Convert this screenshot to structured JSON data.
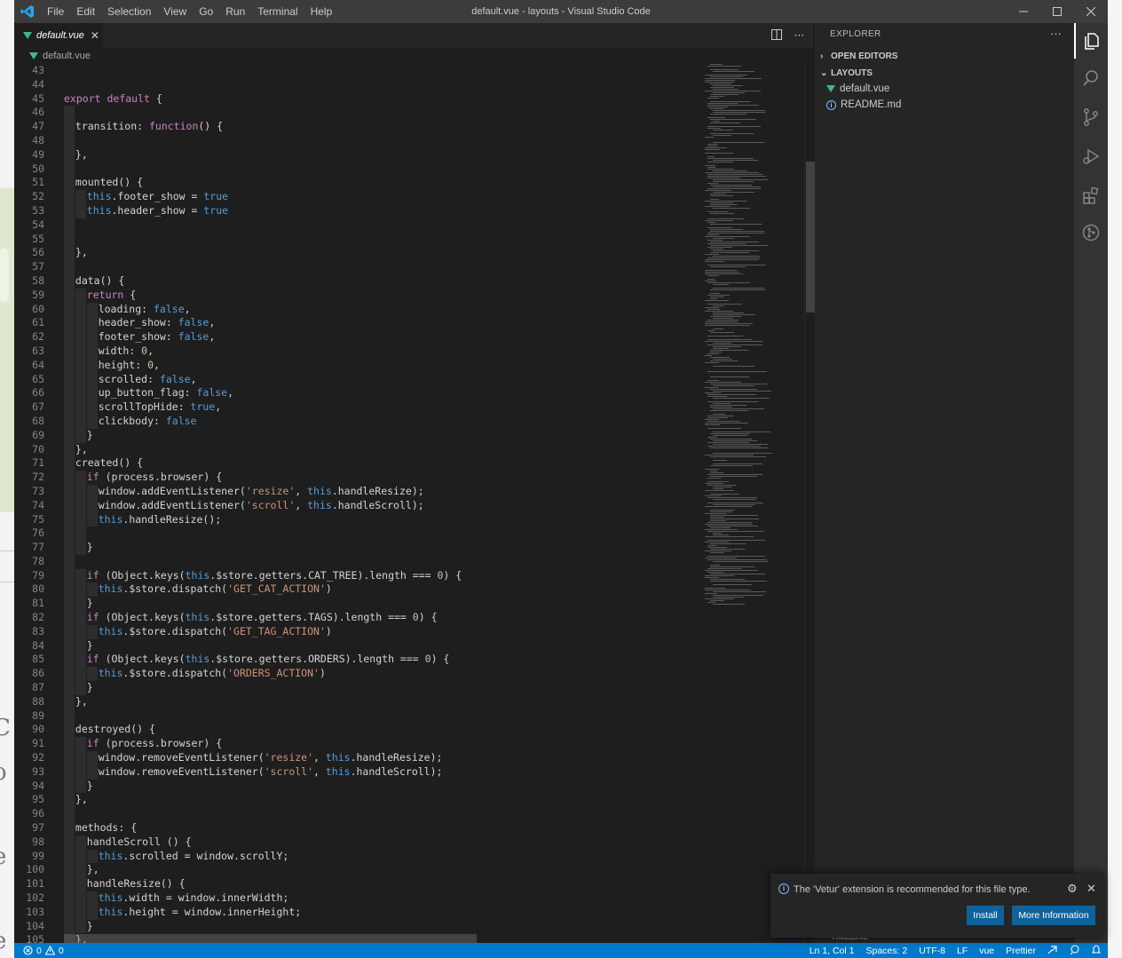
{
  "window": {
    "title": "default.vue - layouts - Visual Studio Code",
    "menu": [
      "File",
      "Edit",
      "Selection",
      "View",
      "Go",
      "Run",
      "Terminal",
      "Help"
    ],
    "controls": [
      "minimize",
      "maximize",
      "close"
    ]
  },
  "editor": {
    "tab_label": "default.vue",
    "breadcrumb": "default.vue",
    "lines": [
      {
        "n": "43",
        "indent": 0,
        "code": ""
      },
      {
        "n": "44",
        "indent": 0,
        "code": ""
      },
      {
        "n": "45",
        "indent": 0,
        "code": "export default {"
      },
      {
        "n": "46",
        "indent": 1,
        "code": ""
      },
      {
        "n": "47",
        "indent": 1,
        "code": "transition: function() {"
      },
      {
        "n": "48",
        "indent": 1,
        "code": ""
      },
      {
        "n": "49",
        "indent": 1,
        "code": "},"
      },
      {
        "n": "50",
        "indent": 1,
        "code": ""
      },
      {
        "n": "51",
        "indent": 1,
        "code": "mounted() {"
      },
      {
        "n": "52",
        "indent": 2,
        "code": "this.footer_show = true"
      },
      {
        "n": "53",
        "indent": 2,
        "code": "this.header_show = true"
      },
      {
        "n": "54",
        "indent": 1,
        "code": ""
      },
      {
        "n": "55",
        "indent": 1,
        "code": ""
      },
      {
        "n": "56",
        "indent": 1,
        "code": "},"
      },
      {
        "n": "57",
        "indent": 1,
        "code": ""
      },
      {
        "n": "58",
        "indent": 1,
        "code": "data() {"
      },
      {
        "n": "59",
        "indent": 2,
        "code": "return {"
      },
      {
        "n": "60",
        "indent": 3,
        "code": "loading: false,"
      },
      {
        "n": "61",
        "indent": 3,
        "code": "header_show: false,"
      },
      {
        "n": "62",
        "indent": 3,
        "code": "footer_show: false,"
      },
      {
        "n": "63",
        "indent": 3,
        "code": "width: 0,"
      },
      {
        "n": "64",
        "indent": 3,
        "code": "height: 0,"
      },
      {
        "n": "65",
        "indent": 3,
        "code": "scrolled: false,"
      },
      {
        "n": "66",
        "indent": 3,
        "code": "up_button_flag: false,"
      },
      {
        "n": "67",
        "indent": 3,
        "code": "scrollTopHide: true,"
      },
      {
        "n": "68",
        "indent": 3,
        "code": "clickbody: false"
      },
      {
        "n": "69",
        "indent": 2,
        "code": "}"
      },
      {
        "n": "70",
        "indent": 1,
        "code": "},"
      },
      {
        "n": "71",
        "indent": 1,
        "code": "created() {"
      },
      {
        "n": "72",
        "indent": 2,
        "code": "if (process.browser) {"
      },
      {
        "n": "73",
        "indent": 3,
        "code": "window.addEventListener('resize', this.handleResize);"
      },
      {
        "n": "74",
        "indent": 3,
        "code": "window.addEventListener('scroll', this.handleScroll);"
      },
      {
        "n": "75",
        "indent": 3,
        "code": "this.handleResize();"
      },
      {
        "n": "76",
        "indent": 2,
        "code": ""
      },
      {
        "n": "77",
        "indent": 2,
        "code": "}"
      },
      {
        "n": "78",
        "indent": 1,
        "code": ""
      },
      {
        "n": "79",
        "indent": 2,
        "code": "if (Object.keys(this.$store.getters.CAT_TREE).length === 0) {"
      },
      {
        "n": "80",
        "indent": 3,
        "code": "this.$store.dispatch('GET_CAT_ACTION')"
      },
      {
        "n": "81",
        "indent": 2,
        "code": "}"
      },
      {
        "n": "82",
        "indent": 2,
        "code": "if (Object.keys(this.$store.getters.TAGS).length === 0) {"
      },
      {
        "n": "83",
        "indent": 3,
        "code": "this.$store.dispatch('GET_TAG_ACTION')"
      },
      {
        "n": "84",
        "indent": 2,
        "code": "}"
      },
      {
        "n": "85",
        "indent": 2,
        "code": "if (Object.keys(this.$store.getters.ORDERS).length === 0) {"
      },
      {
        "n": "86",
        "indent": 3,
        "code": "this.$store.dispatch('ORDERS_ACTION')"
      },
      {
        "n": "87",
        "indent": 2,
        "code": "}"
      },
      {
        "n": "88",
        "indent": 1,
        "code": "},"
      },
      {
        "n": "89",
        "indent": 1,
        "code": ""
      },
      {
        "n": "90",
        "indent": 1,
        "code": "destroyed() {"
      },
      {
        "n": "91",
        "indent": 2,
        "code": "if (process.browser) {"
      },
      {
        "n": "92",
        "indent": 3,
        "code": "window.removeEventListener('resize', this.handleResize);"
      },
      {
        "n": "93",
        "indent": 3,
        "code": "window.removeEventListener('scroll', this.handleScroll);"
      },
      {
        "n": "94",
        "indent": 2,
        "code": "}"
      },
      {
        "n": "95",
        "indent": 1,
        "code": "},"
      },
      {
        "n": "96",
        "indent": 1,
        "code": ""
      },
      {
        "n": "97",
        "indent": 1,
        "code": "methods: {"
      },
      {
        "n": "98",
        "indent": 2,
        "code": "handleScroll () {"
      },
      {
        "n": "99",
        "indent": 3,
        "code": "this.scrolled = window.scrollY;"
      },
      {
        "n": "100",
        "indent": 2,
        "code": "},"
      },
      {
        "n": "101",
        "indent": 2,
        "code": "handleResize() {"
      },
      {
        "n": "102",
        "indent": 3,
        "code": "this.width = window.innerWidth;"
      },
      {
        "n": "103",
        "indent": 3,
        "code": "this.height = window.innerHeight;"
      },
      {
        "n": "104",
        "indent": 2,
        "code": "}"
      },
      {
        "n": "105",
        "indent": 1,
        "code": "},"
      }
    ]
  },
  "explorer": {
    "title": "EXPLORER",
    "open_editors": "OPEN EDITORS",
    "folder": "LAYOUTS",
    "files": [
      {
        "name": "default.vue",
        "icon": "vue-file-icon"
      },
      {
        "name": "README.md",
        "icon": "info-file-icon"
      }
    ],
    "timeline_peek": "TIMELINE"
  },
  "activity_bar": [
    "explorer-icon",
    "search-icon",
    "source-control-icon",
    "run-debug-icon",
    "extensions-icon",
    "git-graph-icon"
  ],
  "notification": {
    "message": "The 'Vetur' extension is recommended for this file type.",
    "install_label": "Install",
    "more_label": "More Information"
  },
  "status_bar": {
    "errors": "0",
    "warnings": "0",
    "position": "Ln 1, Col 1",
    "spaces": "Spaces: 2",
    "encoding": "UTF-8",
    "eol": "LF",
    "language": "vue",
    "formatter": "Prettier"
  },
  "colors": {
    "accent": "#007acc",
    "editor_bg": "#1e1e1e",
    "sidebar_bg": "#252526",
    "titlebar_bg": "#3c3c3c",
    "vue_green": "#41b883"
  }
}
